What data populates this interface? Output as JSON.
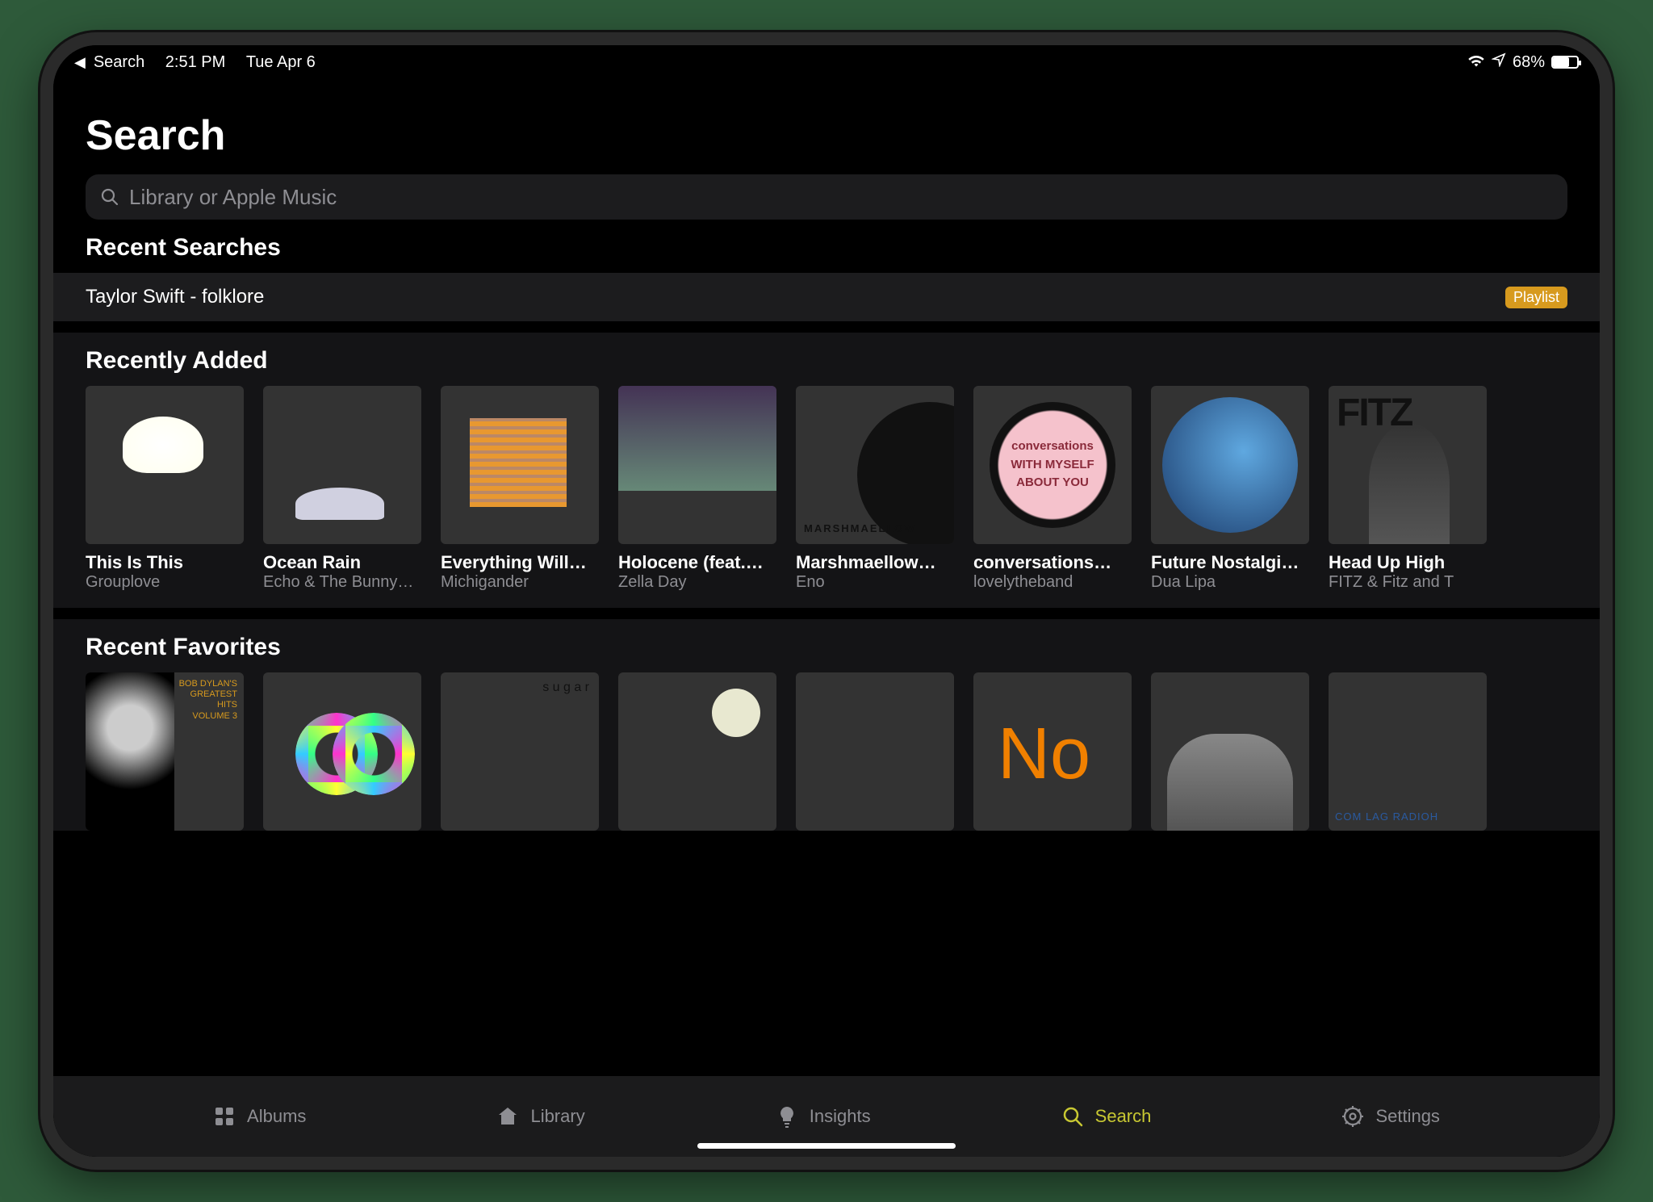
{
  "status": {
    "back_label": "Search",
    "time": "2:51 PM",
    "date": "Tue Apr 6",
    "battery_pct": "68%",
    "battery_fill_pct": 68
  },
  "page": {
    "title": "Search",
    "search_placeholder": "Library or Apple Music"
  },
  "recent_searches": {
    "header": "Recent Searches",
    "items": [
      {
        "label": "Taylor Swift - folklore",
        "badge": "Playlist"
      }
    ]
  },
  "recently_added": {
    "header": "Recently Added",
    "items": [
      {
        "title": "This Is This",
        "artist": "Grouplove"
      },
      {
        "title": "Ocean Rain",
        "artist": "Echo & The Bunny…"
      },
      {
        "title": "Everything Will…",
        "artist": "Michigander"
      },
      {
        "title": "Holocene (feat.…",
        "artist": "Zella Day"
      },
      {
        "title": "Marshmaellow…",
        "artist": "Eno"
      },
      {
        "title": "conversations…",
        "artist": "lovelytheband"
      },
      {
        "title": "Future Nostalgi…",
        "artist": "Dua Lipa"
      },
      {
        "title": "Head Up High",
        "artist": "FITZ & Fitz and T"
      }
    ]
  },
  "recent_favorites": {
    "header": "Recent Favorites"
  },
  "tabs": {
    "albums": "Albums",
    "library": "Library",
    "insights": "Insights",
    "search": "Search",
    "settings": "Settings"
  }
}
